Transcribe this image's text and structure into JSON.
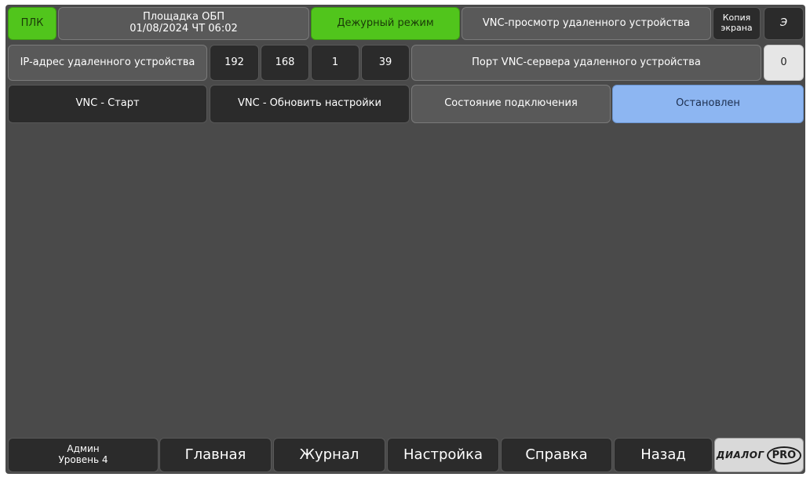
{
  "header": {
    "plc_label": "ПЛК",
    "site_name": "Площадка ОБП",
    "datetime": "01/08/2024 ЧТ 06:02",
    "mode_label": "Дежурный режим",
    "vnc_view_label": "VNC-просмотр удаленного устройства",
    "screenshot_label_line1": "Копия",
    "screenshot_label_line2": "экрана",
    "energy_label": "Э"
  },
  "address_row": {
    "ip_label": "IP-адрес удаленного устройства",
    "ip_octets": [
      "192",
      "168",
      "1",
      "39"
    ],
    "port_label": "Порт VNC-сервера удаленного устройства",
    "port_value": "0"
  },
  "control_row": {
    "vnc_start_label": "VNC - Старт",
    "vnc_update_label": "VNC - Обновить настройки",
    "connection_state_label": "Состояние подключения",
    "connection_state_value": "Остановлен"
  },
  "footer": {
    "user_name": "Админ",
    "user_level": "Уровень 4",
    "nav": [
      "Главная",
      "Журнал",
      "Настройка",
      "Справка",
      "Назад"
    ],
    "logo_text": "ДИАЛОГ",
    "logo_pro": "PRO"
  },
  "colors": {
    "active_green": "#51c51c",
    "status_blue": "#8db6f2",
    "background": "#4a4a4a"
  }
}
